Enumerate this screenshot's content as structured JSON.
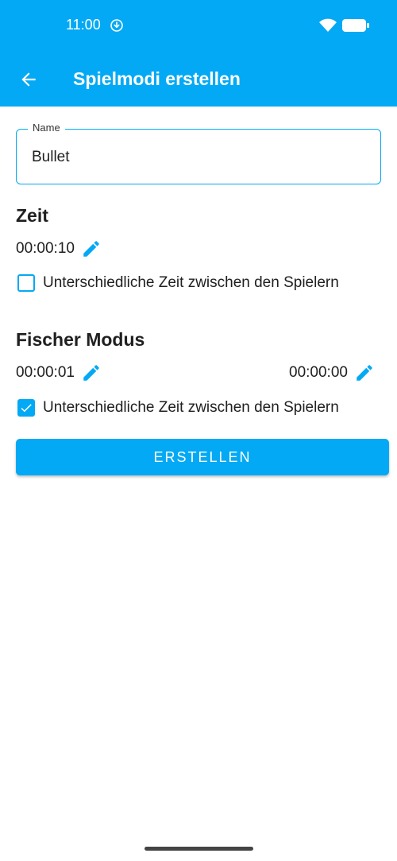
{
  "status_bar": {
    "time": "11:00",
    "icons": [
      "download-indicator-icon",
      "wifi-icon",
      "battery-icon"
    ]
  },
  "app_bar": {
    "title": "Spielmodi erstellen",
    "back_icon": "arrow-back-icon",
    "color": "#03a9f4"
  },
  "name_field": {
    "label": "Name",
    "value": "Bullet"
  },
  "zeit": {
    "heading": "Zeit",
    "time": "00:00:10",
    "edit_icon": "pencil-icon",
    "checkbox_label": "Unterschiedliche Zeit zwischen den Spielern",
    "checked": false
  },
  "fischer": {
    "heading": "Fischer Modus",
    "time_left": "00:00:01",
    "time_right": "00:00:00",
    "edit_icon": "pencil-icon",
    "checkbox_label": "Unterschiedliche Zeit zwischen den Spielern",
    "checked": true
  },
  "create_button": {
    "label": "ERSTELLEN"
  }
}
